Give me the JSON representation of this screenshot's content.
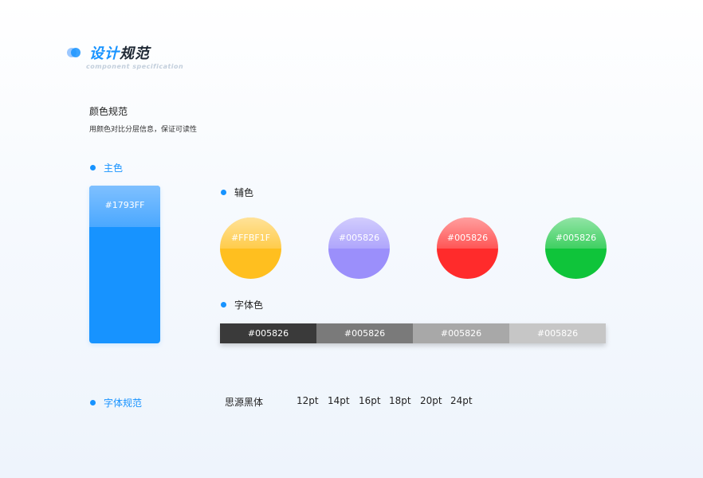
{
  "header": {
    "title_part1": "设计",
    "title_part2": "规范",
    "subtitle": "component specification"
  },
  "color_section": {
    "title": "颜色规范",
    "description": "用颜色对比分层信息，保证可读性"
  },
  "primary": {
    "label": "主色",
    "hex": "#1793FF",
    "color": "#1793ff"
  },
  "secondary": {
    "label": "辅色",
    "swatches": [
      {
        "hex": "#FFBF1F",
        "color": "#ffbf1f"
      },
      {
        "hex": "#005826",
        "color": "#9b8ffb"
      },
      {
        "hex": "#005826",
        "color": "#ff2b2b"
      },
      {
        "hex": "#005826",
        "color": "#0fc43a"
      }
    ]
  },
  "font_color": {
    "label": "字体色",
    "segments": [
      {
        "hex": "#005826",
        "color": "#3a3a3a"
      },
      {
        "hex": "#005826",
        "color": "#7a7a7a"
      },
      {
        "hex": "#005826",
        "color": "#a8a8a8"
      },
      {
        "hex": "#005826",
        "color": "#c6c6c6"
      }
    ]
  },
  "font_spec": {
    "label": "字体规范",
    "font_name": "思源黑体",
    "sizes": [
      "12pt",
      "14pt",
      "16pt",
      "18pt",
      "20pt",
      "24pt"
    ]
  }
}
